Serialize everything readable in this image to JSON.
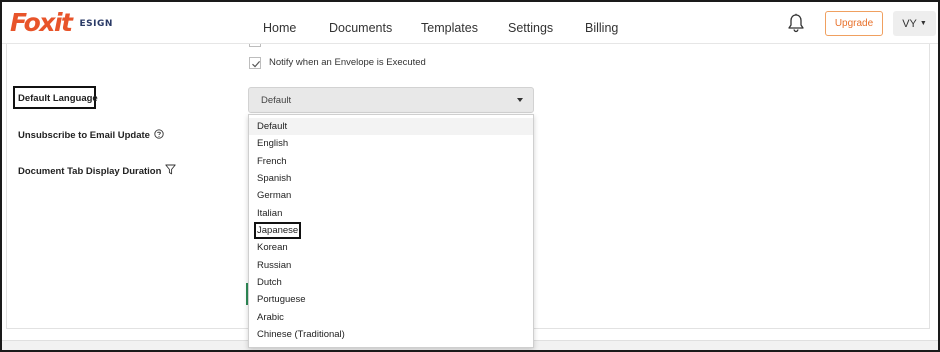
{
  "header": {
    "logo_text": "Foxit",
    "logo_sub": "ESIGN",
    "nav": [
      "Home",
      "Documents",
      "Templates",
      "Settings",
      "Billing"
    ],
    "upgrade_label": "Upgrade",
    "user_initials": "VY"
  },
  "settings": {
    "notify_label": "Notify when an Envelope is Executed",
    "notify_checked": true,
    "default_language_label": "Default Language",
    "unsubscribe_label": "Unsubscribe to Email Update",
    "tab_duration_label": "Document Tab Display Duration"
  },
  "language_select": {
    "selected": "Default",
    "options": [
      "Default",
      "English",
      "French",
      "Spanish",
      "German",
      "Italian",
      "Japanese",
      "Korean",
      "Russian",
      "Dutch",
      "Portuguese",
      "Arabic",
      "Chinese (Traditional)"
    ]
  },
  "colors": {
    "brand": "#e8542a",
    "upgrade": "#e8702a"
  },
  "icons": {
    "bell": "bell-icon",
    "help": "help-circle-icon",
    "filter": "filter-icon",
    "check": "check-icon",
    "caret": "caret-down-icon"
  }
}
